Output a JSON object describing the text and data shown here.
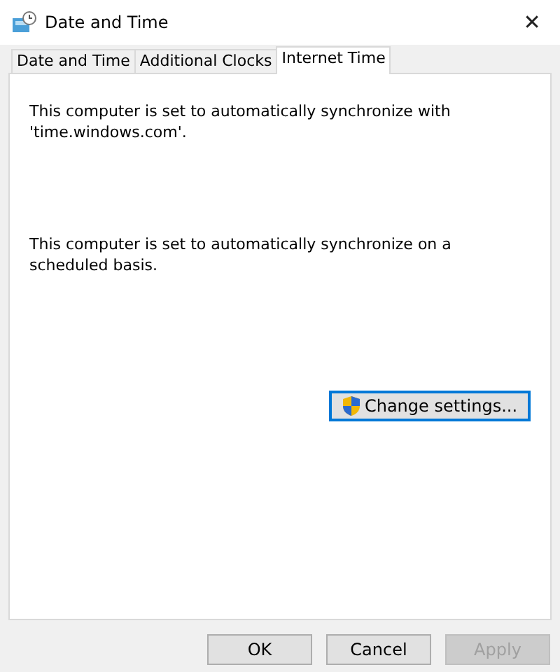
{
  "window": {
    "title": "Date and Time",
    "close": "✕"
  },
  "tabs": [
    {
      "label": "Date and Time",
      "selected": false
    },
    {
      "label": "Additional Clocks",
      "selected": false
    },
    {
      "label": "Internet Time",
      "selected": true
    }
  ],
  "panel": {
    "messages": [
      "This computer is set to automatically synchronize with 'time.windows.com'.",
      "This computer is set to automatically synchronize on a scheduled basis."
    ],
    "change_button": {
      "label": "Change settings...",
      "disabled": false
    }
  },
  "buttons": [
    {
      "label": "OK",
      "disabled": false
    },
    {
      "label": "Cancel",
      "disabled": false
    },
    {
      "label": "Apply",
      "disabled": true
    }
  ]
}
